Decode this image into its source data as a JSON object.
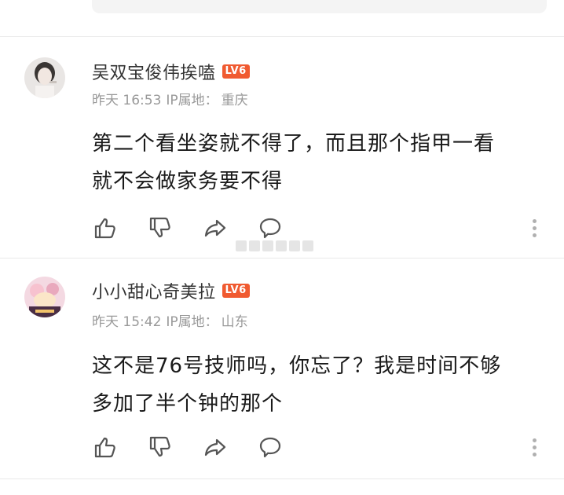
{
  "comments": [
    {
      "username": "吴双宝俊伟挨嗑",
      "level": "LV6",
      "time": "昨天 16:53",
      "ip_label": "IP属地：",
      "ip_location": "重庆",
      "content_line1": "第二个看坐姿就不得了，而且那个指甲一看",
      "content_line2": "就不会做家务要不得"
    },
    {
      "username": "小小甜心奇美拉",
      "level": "LV6",
      "time": "昨天 15:42",
      "ip_label": "IP属地：",
      "ip_location": "山东",
      "content_line1": "这不是76号技师吗，你忘了？我是时间不够",
      "content_line2": "多加了半个钟的那个"
    }
  ],
  "icons": {
    "like": "thumbs-up-icon",
    "dislike": "thumbs-down-icon",
    "share": "share-icon",
    "reply": "comment-icon",
    "more": "more-vertical-icon"
  },
  "colors": {
    "level_badge": "#f05a30",
    "meta_text": "#999999",
    "icon_stroke": "#555555"
  }
}
